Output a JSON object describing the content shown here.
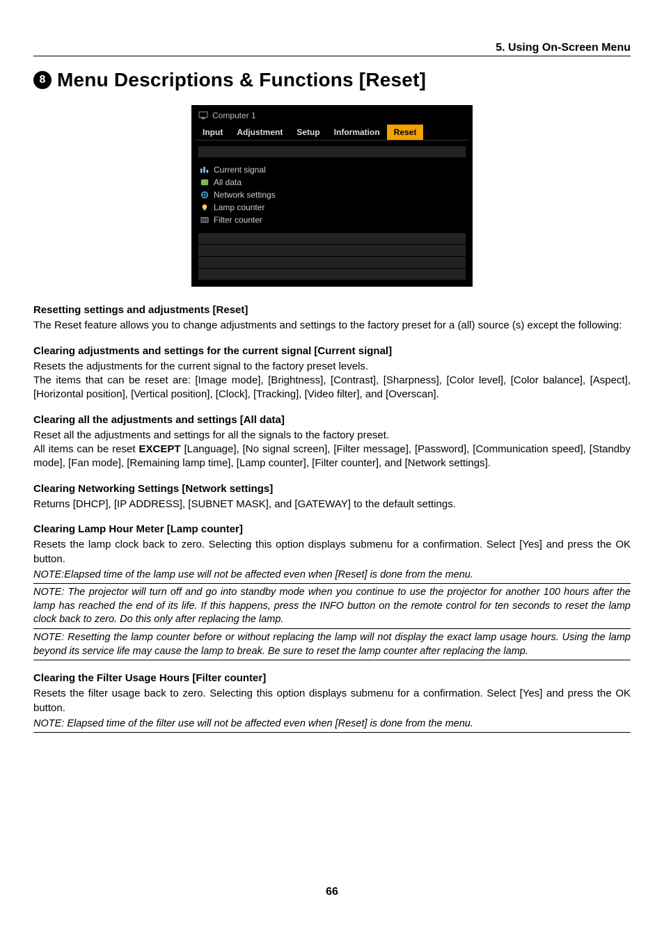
{
  "header": {
    "section": "5. Using On-Screen Menu"
  },
  "title": {
    "num": "8",
    "text": "Menu Descriptions & Functions [Reset]"
  },
  "osd": {
    "source": "Computer 1",
    "tabs": {
      "t0": "Input",
      "t1": "Adjustment",
      "t2": "Setup",
      "t3": "Information",
      "t4": "Reset"
    },
    "items": {
      "i0": "Current signal",
      "i1": "All data",
      "i2": "Network settings",
      "i3": "Lamp counter",
      "i4": "Filter counter"
    }
  },
  "sections": {
    "s1h": "Resetting settings and adjustments [Reset]",
    "s1p": "The Reset feature allows you to change adjustments and settings to the factory preset for a (all) source (s) except the following:",
    "s2h": "Clearing adjustments and settings for the current signal [Current signal]",
    "s2p1": "Resets the adjustments for the current signal to the factory preset levels.",
    "s2p2": "The items that can be reset are: [Image mode], [Brightness], [Contrast], [Sharpness], [Color level], [Color balance], [Aspect], [Horizontal position], [Vertical position], [Clock], [Tracking], [Video filter], and [Overscan].",
    "s3h": "Clearing all the adjustments and settings [All data]",
    "s3p1": "Reset all the adjustments and settings for all the signals to the factory preset.",
    "s3p2a": "All items can be reset ",
    "s3except": "EXCEPT",
    "s3p2b": " [Language], [No signal screen], [Filter message], [Password], [Communication speed], [Standby mode], [Fan mode], [Remaining lamp time], [Lamp counter], [Filter counter], and [Network settings].",
    "s4h": "Clearing Networking Settings [Network settings]",
    "s4p": "Returns [DHCP], [IP ADDRESS], [SUBNET MASK], and [GATEWAY] to the default settings.",
    "s5h": "Clearing Lamp Hour Meter [Lamp counter]",
    "s5p": "Resets the lamp clock back to zero. Selecting this option displays submenu for a confirmation. Select [Yes] and press the OK button.",
    "s5n1": "NOTE:Elapsed time of the lamp use will not be affected even when [Reset] is done from the menu.",
    "s5n2": "NOTE: The projector will turn off and go into standby mode when you continue to use the projector for another 100 hours after the lamp has reached the end of its life. If this happens, press the INFO button on the remote control for ten seconds to reset the lamp clock back to zero. Do this only after replacing the lamp.",
    "s5n3": "NOTE: Resetting the lamp counter before or without replacing the lamp will not display the exact lamp usage hours. Using the lamp beyond its service life may cause the lamp to break. Be sure to reset the lamp counter after replacing the lamp.",
    "s6h": "Clearing the Filter Usage Hours [Filter counter]",
    "s6p": "Resets the filter usage back to zero. Selecting this option displays submenu for a confirmation. Select [Yes] and press the OK button.",
    "s6n1": "NOTE: Elapsed time of the filter use will not be affected even when [Reset] is done from the menu."
  },
  "pagenum": "66"
}
